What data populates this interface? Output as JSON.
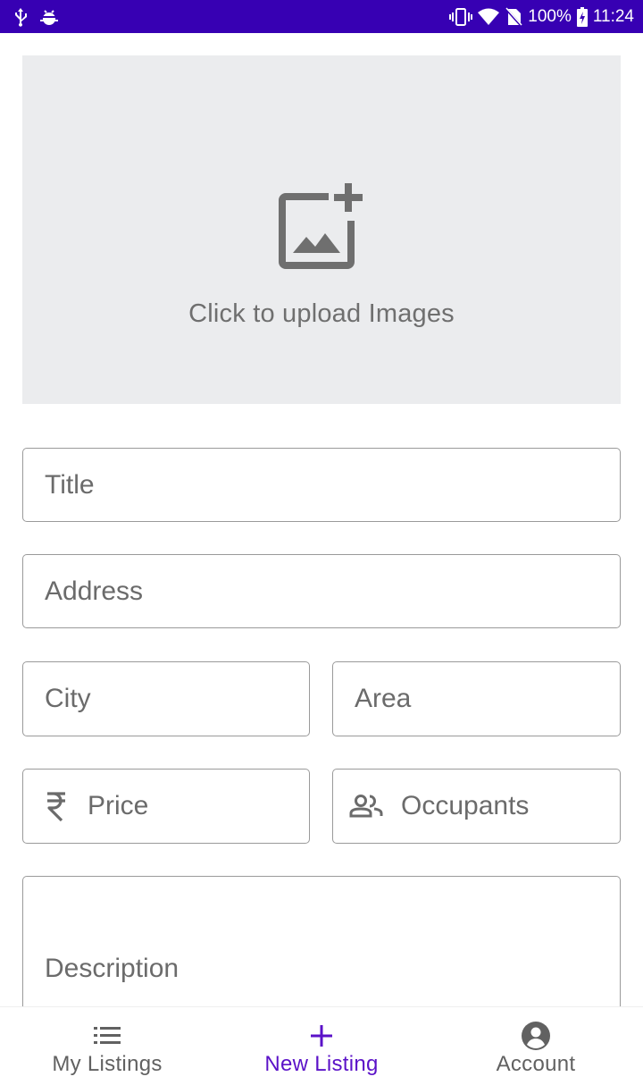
{
  "status_bar": {
    "battery": "100%",
    "time": "11:24",
    "left_icons": [
      "usb-icon",
      "debug-bug-icon"
    ],
    "right_icons": [
      "vibrate-icon",
      "wifi-icon",
      "no-sim-icon",
      "battery-icon"
    ]
  },
  "upload": {
    "label": "Click to upload Images",
    "icon": "add-photo-icon"
  },
  "form": {
    "title_placeholder": "Title",
    "address_placeholder": "Address",
    "city_placeholder": "City",
    "area_placeholder": "Area",
    "price_placeholder": "Price",
    "price_icon": "rupee-icon",
    "occupants_placeholder": "Occupants",
    "occupants_icon": "people-icon",
    "description_placeholder": "Description"
  },
  "nav": {
    "items": [
      {
        "label": "My Listings",
        "icon": "list-icon",
        "active": false
      },
      {
        "label": "New Listing",
        "icon": "plus-icon",
        "active": true
      },
      {
        "label": "Account",
        "icon": "account-circle-icon",
        "active": false
      }
    ]
  },
  "colors": {
    "status_bar": "#3700b3",
    "accent": "#5b12c8",
    "upload_bg": "#ebecee",
    "field_border": "#9a9a9a",
    "placeholder_text": "#6b6b6b"
  }
}
